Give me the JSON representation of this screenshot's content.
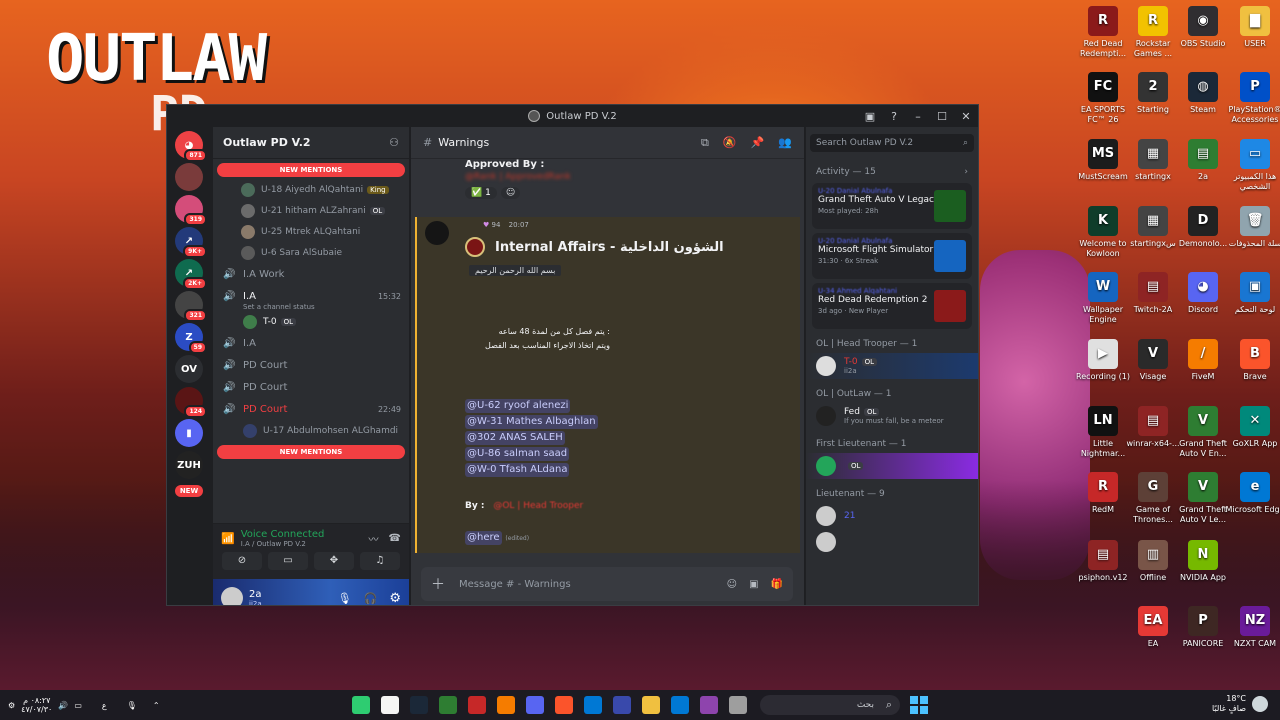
{
  "wallpaper": {
    "brand_line1": "OUTLAW",
    "brand_line2": "PD"
  },
  "desktop_icons": [
    {
      "label": "Red Dead Redempti...",
      "color": "#8b1a1a",
      "glyph": "R"
    },
    {
      "label": "Rockstar Games ...",
      "color": "#f2c200",
      "glyph": "R"
    },
    {
      "label": "OBS Studio",
      "color": "#302e31",
      "glyph": "◉"
    },
    {
      "label": "USER",
      "color": "#f0c040",
      "glyph": "▇"
    },
    {
      "label": "EA SPORTS FC™ 26",
      "color": "#111111",
      "glyph": "FC"
    },
    {
      "label": "Starting",
      "color": "#333333",
      "glyph": "2"
    },
    {
      "label": "Steam",
      "color": "#1b2838",
      "glyph": "◍"
    },
    {
      "label": "PlayStation® Accessories",
      "color": "#0050c8",
      "glyph": "P"
    },
    {
      "label": "MustScream",
      "color": "#1c1c1c",
      "glyph": "MS"
    },
    {
      "label": "startingx",
      "color": "#444444",
      "glyph": "▦"
    },
    {
      "label": "2a",
      "color": "#2e7d32",
      "glyph": "▤"
    },
    {
      "label": "هذا الكمبيوتر الشخصي",
      "color": "#1e88e5",
      "glyph": "▭"
    },
    {
      "label": "Welcome to Kowloon",
      "color": "#0f3d2a",
      "glyph": "K"
    },
    {
      "label": "startingxس",
      "color": "#444444",
      "glyph": "▦"
    },
    {
      "label": "Demonolo...",
      "color": "#222222",
      "glyph": "D"
    },
    {
      "label": "سلة المحذوفات",
      "color": "#90a4ae",
      "glyph": "🗑"
    },
    {
      "label": "Wallpaper Engine",
      "color": "#1565c0",
      "glyph": "W"
    },
    {
      "label": "Twitch-2A",
      "color": "#8e2424",
      "glyph": "▤"
    },
    {
      "label": "Discord",
      "color": "#5865f2",
      "glyph": "◕"
    },
    {
      "label": "لوحة التحكم",
      "color": "#1976d2",
      "glyph": "▣"
    },
    {
      "label": "Recording (1)",
      "color": "#e0e0e0",
      "glyph": "▶"
    },
    {
      "label": "Visage",
      "color": "#2a2a2a",
      "glyph": "V"
    },
    {
      "label": "FiveM",
      "color": "#f57c00",
      "glyph": "/"
    },
    {
      "label": "Brave",
      "color": "#fb542b",
      "glyph": "B"
    },
    {
      "label": "Little Nightmar...",
      "color": "#111111",
      "glyph": "LN"
    },
    {
      "label": "winrar-x64-...",
      "color": "#8e2424",
      "glyph": "▤"
    },
    {
      "label": "Grand Theft Auto V En...",
      "color": "#2e7d32",
      "glyph": "V"
    },
    {
      "label": "GoXLR App",
      "color": "#00897b",
      "glyph": "✕"
    },
    {
      "label": "RedM",
      "color": "#c62828",
      "glyph": "R"
    },
    {
      "label": "Game of Thrones...",
      "color": "#5d4037",
      "glyph": "G"
    },
    {
      "label": "Grand Theft Auto V Le...",
      "color": "#2e7d32",
      "glyph": "V"
    },
    {
      "label": "Microsoft Edge",
      "color": "#0078d4",
      "glyph": "e"
    },
    {
      "label": "psiphon.v12",
      "color": "#8e2424",
      "glyph": "▤"
    },
    {
      "label": "Offline",
      "color": "#795548",
      "glyph": "▥"
    },
    {
      "label": "NVIDIA App",
      "color": "#76b900",
      "glyph": "N"
    },
    {
      "label": "EA",
      "color": "#e53935",
      "glyph": "EA"
    },
    {
      "label": "PANICORE",
      "color": "#3e2723",
      "glyph": "P"
    },
    {
      "label": "NZXT CAM",
      "color": "#6a1b9a",
      "glyph": "NZ"
    }
  ],
  "window": {
    "title": "Outlaw PD V.2"
  },
  "servers": [
    {
      "badge": "871",
      "color": "#ed4245",
      "glyph": "◕"
    },
    {
      "badge": "",
      "color": "#7a3b3b",
      "glyph": ""
    },
    {
      "badge": "319",
      "color": "#d44d7a",
      "glyph": ""
    },
    {
      "badge": "9K+",
      "color": "#233a7a",
      "glyph": "↗"
    },
    {
      "badge": "2K+",
      "color": "#0f6b4f",
      "glyph": "↗"
    },
    {
      "badge": "321",
      "color": "#444",
      "glyph": ""
    },
    {
      "badge": "59",
      "color": "#2b4cc4",
      "glyph": "Z"
    },
    {
      "badge": "",
      "color": "#2b2d31",
      "glyph": "OV"
    },
    {
      "badge": "124",
      "color": "#5a1515",
      "glyph": ""
    },
    {
      "badge": "",
      "color": "#5865f2",
      "glyph": "▮"
    },
    {
      "badge": "",
      "color": "#222",
      "glyph": "ZUH"
    }
  ],
  "new_badge": "NEW",
  "sidebar": {
    "server_name": "Outlaw PD V.2",
    "new_mentions": "NEW MENTIONS",
    "members_top": [
      {
        "name": "U-18 Aiyedh AlQahtani",
        "tag": "King"
      },
      {
        "name": "U-21 hitham ALZahrani",
        "tag": "OL"
      },
      {
        "name": "U-25 Mtrek ALQahtani",
        "tag": ""
      },
      {
        "name": "U-6 Sara AlSubaie",
        "tag": ""
      }
    ],
    "channels": [
      {
        "name": "I.A Work",
        "time": "",
        "status": ""
      },
      {
        "name": "I.A",
        "time": "15:32",
        "status": "Set a channel status"
      }
    ],
    "ia_member": {
      "name": "T-0",
      "tag": "OL"
    },
    "channels2": [
      {
        "name": "I.A",
        "time": ""
      },
      {
        "name": "PD Court",
        "time": ""
      },
      {
        "name": "PD Court",
        "time": ""
      },
      {
        "name": "PD Court",
        "time": "22:49"
      }
    ],
    "court_member": "U-17 Abdulmohsen ALGhamdi",
    "voice_status": "Voice Connected",
    "voice_channel": "I.A / Outlaw PD V.2",
    "user_name": "2a",
    "user_status": "ii2a"
  },
  "chat": {
    "channel_name": "Warnings",
    "approved_by": "Approved By :",
    "approved_redacted": "@Rank | ApprovedRank",
    "reaction_count": "1",
    "msg_count": "94",
    "msg_time": "20:07",
    "embed_title": "Internal Affairs - الشؤون الداخلية",
    "bismillah": "بسم الله الرحمن الرحيم",
    "line1": ":  يتم فصل كل من لمدة 48 ساعه",
    "line2": "ويتم اتخاذ الاجراء المناسب بعد الفصل",
    "mentions": [
      "@U-62 ryoof alenezi",
      "@W-31 Mathes Albaghlan",
      "@302 ANAS SALEH",
      "@U-86 salman saad",
      "@W-0 Tfash ALdana"
    ],
    "by_label": "By :",
    "by_role": "@OL | Head Trooper",
    "here": "@here",
    "edited": "(edited)",
    "placeholder": "Message # - Warnings"
  },
  "right": {
    "search_placeholder": "Search Outlaw PD V.2",
    "activity_header": "Activity — 15",
    "activities": [
      {
        "user": "U-20 Danial Abulnafa",
        "game": "Grand Theft Auto V Legacy",
        "sub": "Most played: 28h",
        "color": "#1b5e20"
      },
      {
        "user": "U-20 Danial Abulnafa",
        "game": "Microsoft Flight Simulator",
        "sub": "31:30 · 6x Streak",
        "color": "#1565c0"
      },
      {
        "user": "U-34 Ahmed Alqahtani",
        "game": "Red Dead Redemption 2",
        "sub": "3d ago · New Player",
        "color": "#8b1a1a"
      }
    ],
    "roles": [
      {
        "title": "OL | Head Trooper — 1",
        "members": [
          {
            "name": "T-0",
            "sub": "ii2a",
            "tag": "OL"
          }
        ]
      },
      {
        "title": "OL | OutLaw — 1",
        "members": [
          {
            "name": "Fed",
            "sub": "If you must fall, be a meteor",
            "tag": "OL"
          }
        ]
      },
      {
        "title": "First Lieutenant — 1",
        "members": [
          {
            "name": "",
            "sub": "",
            "tag": "OL"
          }
        ]
      },
      {
        "title": "Lieutenant — 9",
        "members": [
          {
            "name": "21",
            "sub": "",
            "tag": ""
          },
          {
            "name": "",
            "sub": "",
            "tag": ""
          }
        ]
      }
    ]
  },
  "taskbar": {
    "search_text": "بحث",
    "weather_temp": "18°C",
    "weather_desc": "صافٍ غالبًا",
    "clock_time": "٠٨:٢٧ م",
    "clock_date": "٤٧/٠٧/٣٠",
    "lang": "ع"
  }
}
